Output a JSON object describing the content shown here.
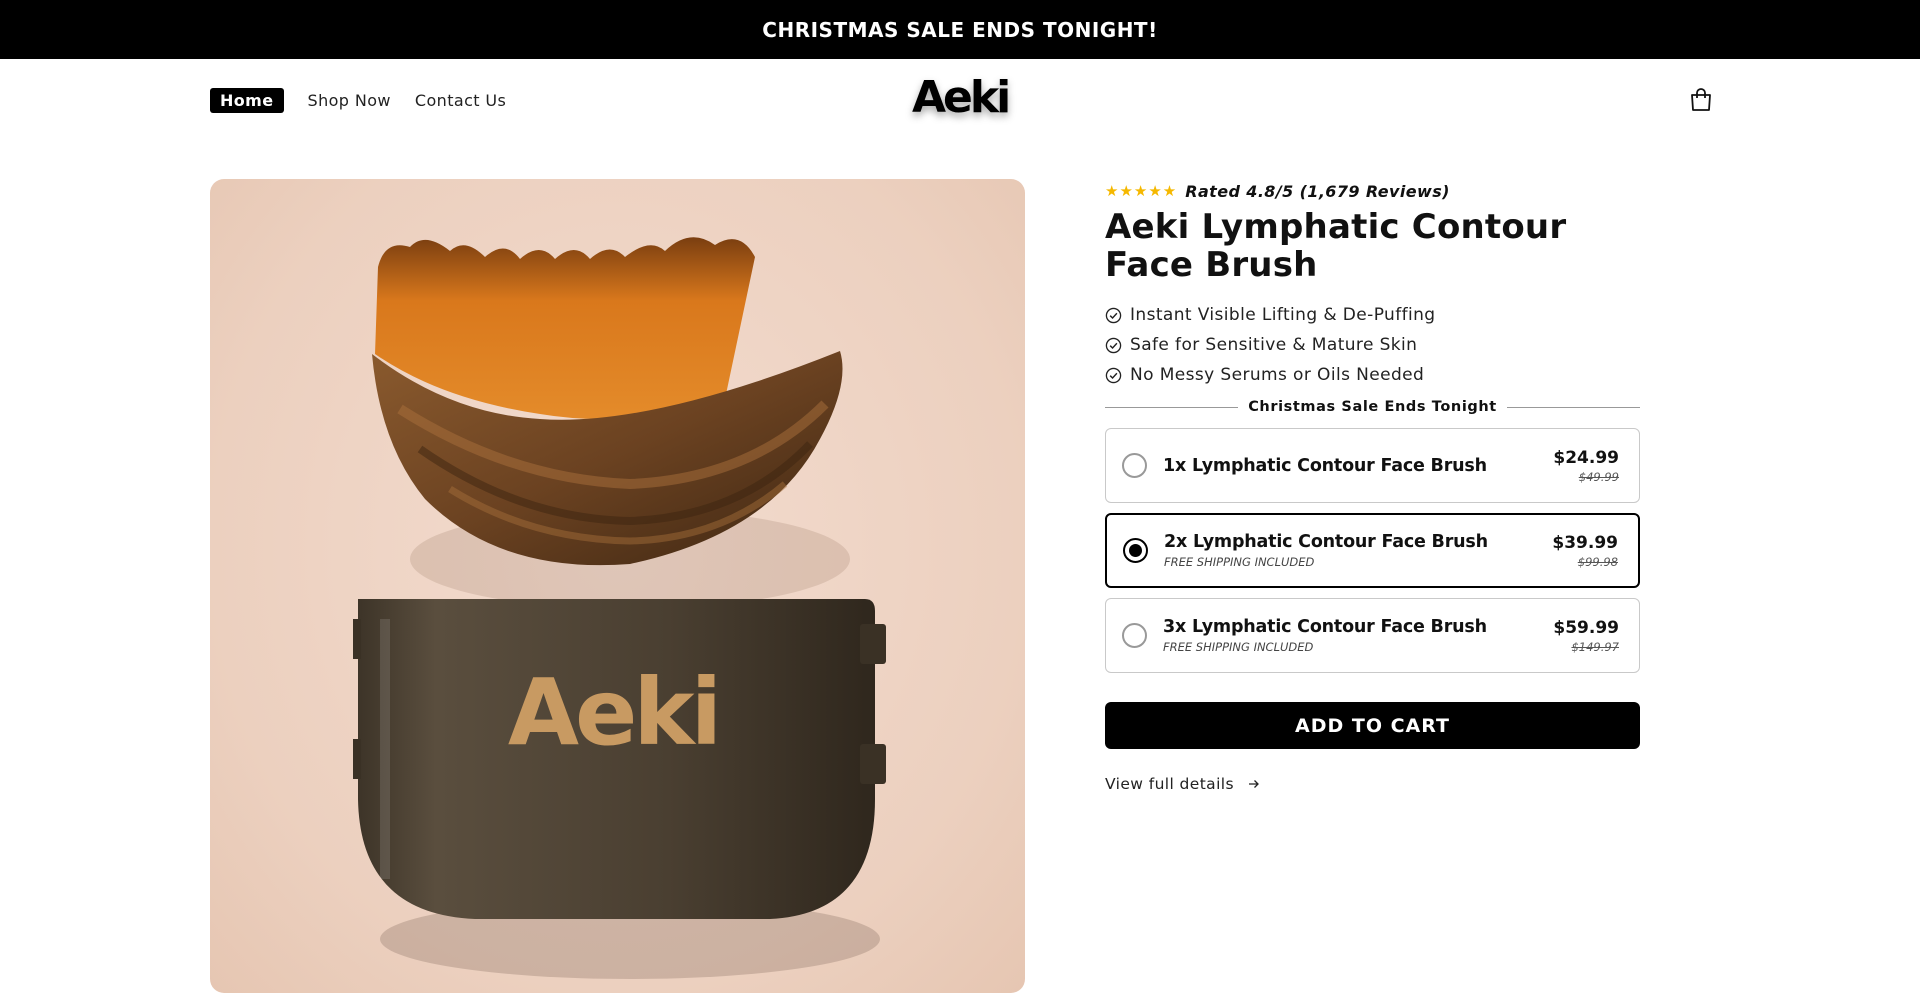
{
  "announcement": "CHRISTMAS SALE ENDS TONIGHT!",
  "nav": {
    "items": [
      "Home",
      "Shop Now",
      "Contact Us"
    ],
    "active": "Home"
  },
  "brand": {
    "logo_text": "Aeki",
    "case_print": "Aeki"
  },
  "icons": {
    "cart": "shopping-bag-icon",
    "star": "star-icon",
    "check": "check-circle-icon",
    "arrow": "arrow-right-icon"
  },
  "product": {
    "rating_text": "Rated 4.8/5 (1,679 Reviews)",
    "stars": 5,
    "title": "Aeki Lymphatic Contour Face Brush",
    "benefits": [
      "Instant Visible Lifting & De-Puffing",
      "Safe for Sensitive & Mature Skin",
      "No Messy Serums or Oils Needed"
    ],
    "divider_label": "Christmas Sale Ends Tonight",
    "options": [
      {
        "name": "1x Lymphatic Contour Face Brush",
        "sub": "",
        "price": "$24.99",
        "old_price": "$49.99",
        "selected": false
      },
      {
        "name": "2x Lymphatic Contour Face Brush",
        "sub": "FREE SHIPPING INCLUDED",
        "price": "$39.99",
        "old_price": "$99.98",
        "selected": true
      },
      {
        "name": "3x Lymphatic Contour Face Brush",
        "sub": "FREE SHIPPING INCLUDED",
        "price": "$59.99",
        "old_price": "$149.97",
        "selected": false
      }
    ],
    "add_to_cart": "ADD TO CART",
    "view_details": "View full details"
  },
  "colors": {
    "announce_bg": "#000000",
    "star": "#f5b800",
    "image_bg": "#ecd0bf",
    "case": "#4a3f31",
    "case_print": "#c89a62",
    "bristles": "#d9781c"
  }
}
